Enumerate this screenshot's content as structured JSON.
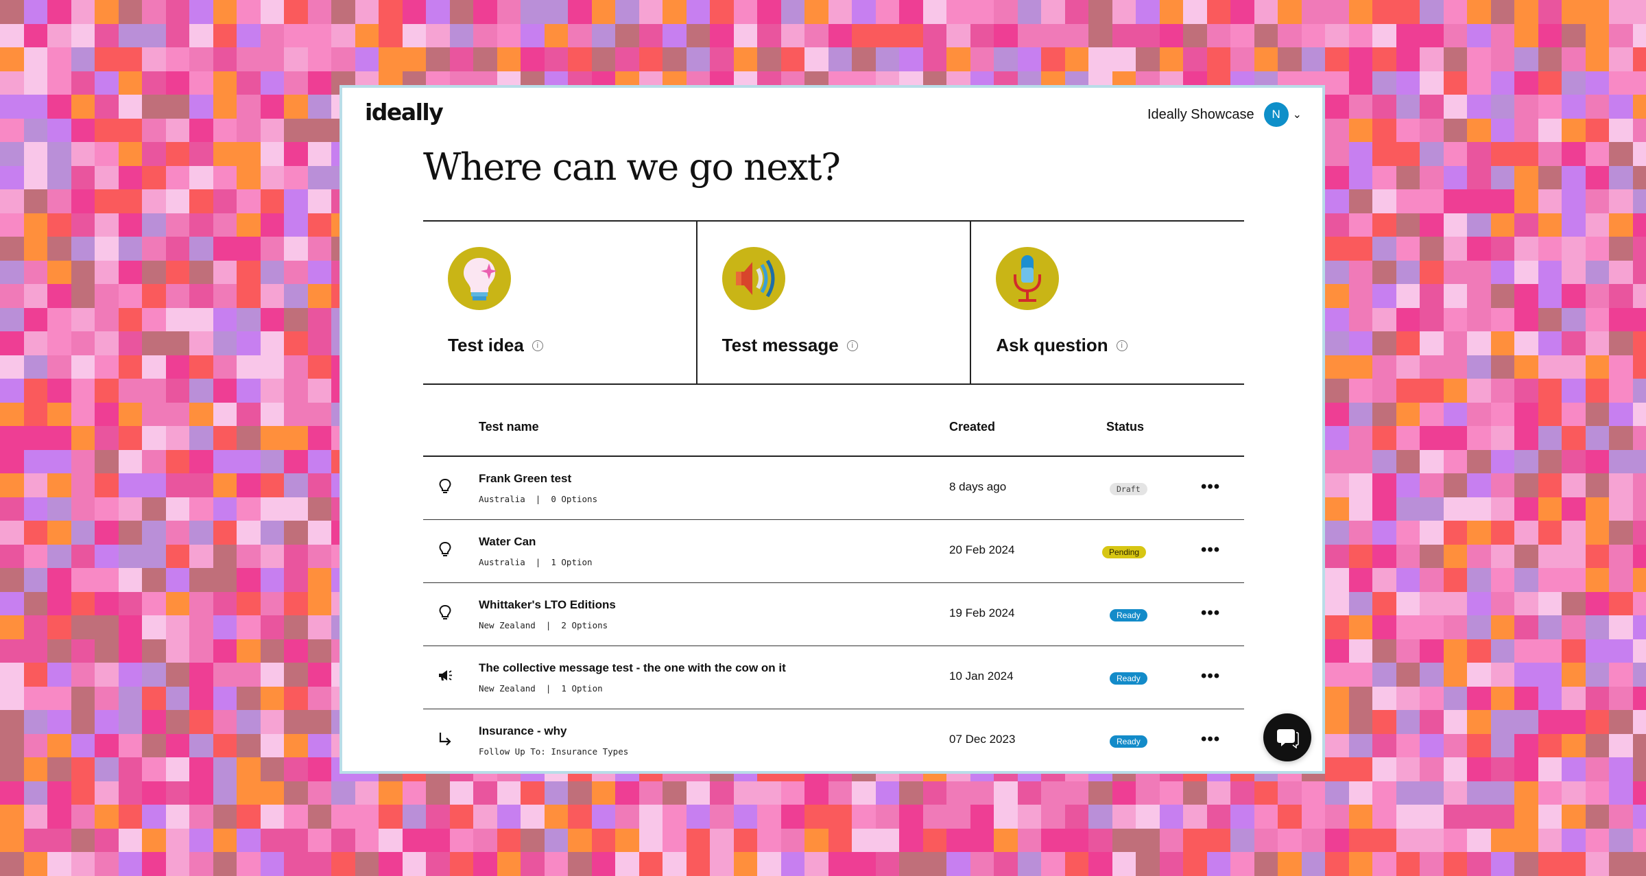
{
  "background_palette": [
    "#f07ab8",
    "#ee3e94",
    "#f6a3d3",
    "#f889c5",
    "#ff8f3c",
    "#c06f7a",
    "#c77ff0",
    "#fa5a5c",
    "#f9c6e9",
    "#e9559e",
    "#ba8fd8"
  ],
  "brand": {
    "logo_text": "ideally"
  },
  "account": {
    "name": "Ideally Showcase",
    "initial": "N",
    "avatar_color": "#0e8fc9"
  },
  "page": {
    "title": "Where can we go next?"
  },
  "actions": [
    {
      "label": "Test idea",
      "icon": "lightbulb-icon"
    },
    {
      "label": "Test message",
      "icon": "speaker-icon"
    },
    {
      "label": "Ask question",
      "icon": "microphone-icon"
    }
  ],
  "table": {
    "columns": {
      "name": "Test name",
      "created": "Created",
      "status": "Status"
    },
    "rows": [
      {
        "icon": "lightbulb-icon",
        "title": "Frank Green test",
        "sub": "Australia  |  0 Options",
        "created": "8 days ago",
        "status": "Draft"
      },
      {
        "icon": "lightbulb-icon",
        "title": "Water Can",
        "sub": "Australia  |  1 Option",
        "created": "20 Feb 2024",
        "status": "Pending"
      },
      {
        "icon": "lightbulb-icon",
        "title": "Whittaker's LTO Editions",
        "sub": "New Zealand  |  2 Options",
        "created": "19 Feb 2024",
        "status": "Ready"
      },
      {
        "icon": "megaphone-icon",
        "title": "The collective message test - the one with the cow on it",
        "sub": "New Zealand  |  1 Option",
        "created": "10 Jan 2024",
        "status": "Ready"
      },
      {
        "icon": "follow-up-arrow-icon",
        "title": "Insurance - why",
        "sub": "Follow Up To: Insurance Types",
        "created": "07 Dec 2023",
        "status": "Ready"
      }
    ],
    "more_label": "•••"
  },
  "status_colors": {
    "Draft": "#e4e4e4",
    "Pending": "#d7c613",
    "Ready": "#138bc9"
  },
  "icons": {
    "chevron": "chevron-down-icon",
    "info": "info-icon",
    "chat": "chat-icon"
  }
}
